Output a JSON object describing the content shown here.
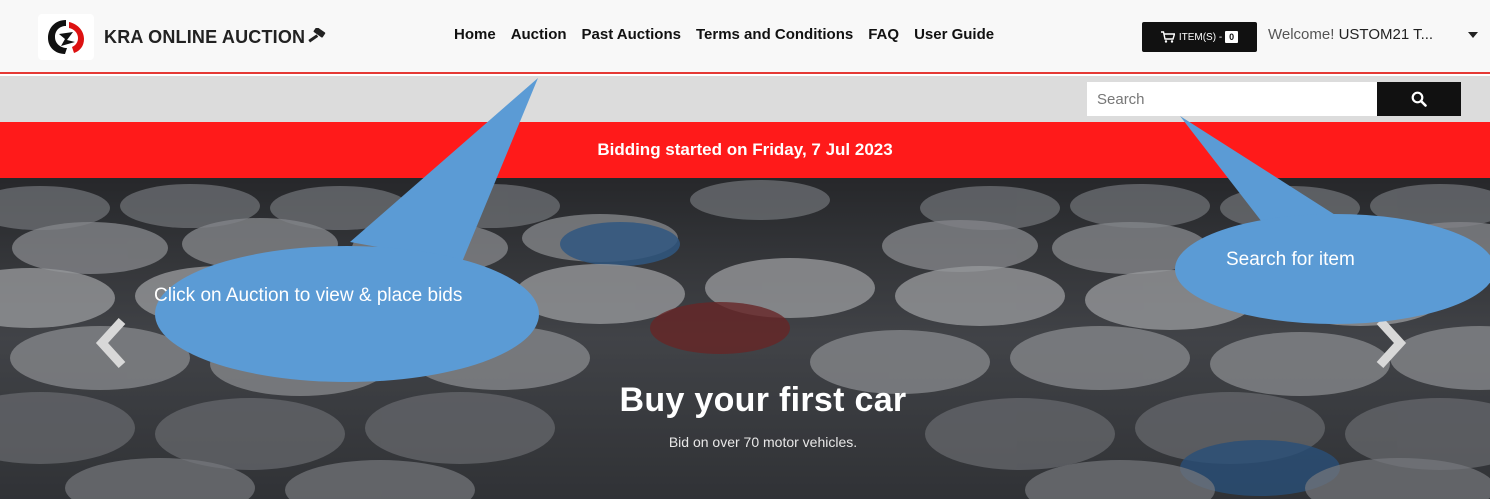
{
  "brand": {
    "name": "KRA ONLINE AUCTION",
    "logo_icon": "lion-head-icon",
    "gavel_icon": "gavel-icon"
  },
  "nav": {
    "items": [
      {
        "label": "Home"
      },
      {
        "label": "Auction"
      },
      {
        "label": "Past Auctions"
      },
      {
        "label": "Terms and Conditions"
      },
      {
        "label": "FAQ"
      },
      {
        "label": "User Guide"
      }
    ]
  },
  "cart": {
    "icon": "cart-icon",
    "label": "ITEM(S) -",
    "count": "0"
  },
  "user": {
    "greeting": "Welcome!",
    "name": "USTOM21 T..."
  },
  "search": {
    "placeholder": "Search",
    "icon": "search-icon"
  },
  "banner": {
    "text": "Bidding started on Friday, 7 Jul 2023"
  },
  "hero": {
    "title": "Buy your first car",
    "subtitle": "Bid on over 70 motor vehicles."
  },
  "annotations": {
    "auction": "Click on Auction to view & place bids",
    "search": "Search for item"
  },
  "colors": {
    "accent_red": "#ff1a1a",
    "navbar_border": "#e53935",
    "callout_blue": "#5b9bd5",
    "dark": "#111111"
  }
}
